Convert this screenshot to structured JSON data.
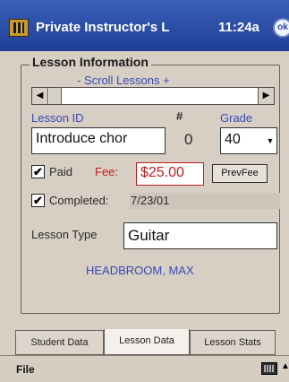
{
  "titlebar": {
    "title": "Private Instructor's L",
    "time": "11:24a",
    "ok_label": "ok"
  },
  "lesson_group": {
    "legend": "Lesson Information",
    "scroll_lessons": "-  Scroll Lessons  +"
  },
  "fields": {
    "lesson_id_label": "Lesson ID",
    "hash_label": "#",
    "grade_label": "Grade",
    "lesson_id_value": "Introduce chor",
    "number_value": "0",
    "grade_value": "40",
    "paid_label": "Paid",
    "paid_checked": true,
    "fee_label": "Fee:",
    "fee_value": "$25.00",
    "prev_fee_label": "PrevFee",
    "completed_label": "Completed:",
    "completed_checked": true,
    "completed_date": "7/23/01",
    "lesson_type_label": "Lesson Type",
    "lesson_type_value": "Guitar",
    "student_name": "HEADBROOM, MAX"
  },
  "tabs": [
    {
      "label": "Student Data",
      "active": false
    },
    {
      "label": "Lesson Data",
      "active": true
    },
    {
      "label": "Lesson Stats",
      "active": false
    }
  ],
  "menubar": {
    "file_label": "File"
  },
  "colors": {
    "title_bar": "#1f3f96",
    "link_blue": "#3a49b4",
    "fee_red": "#c21e1e",
    "background": "#d8cfc4"
  }
}
